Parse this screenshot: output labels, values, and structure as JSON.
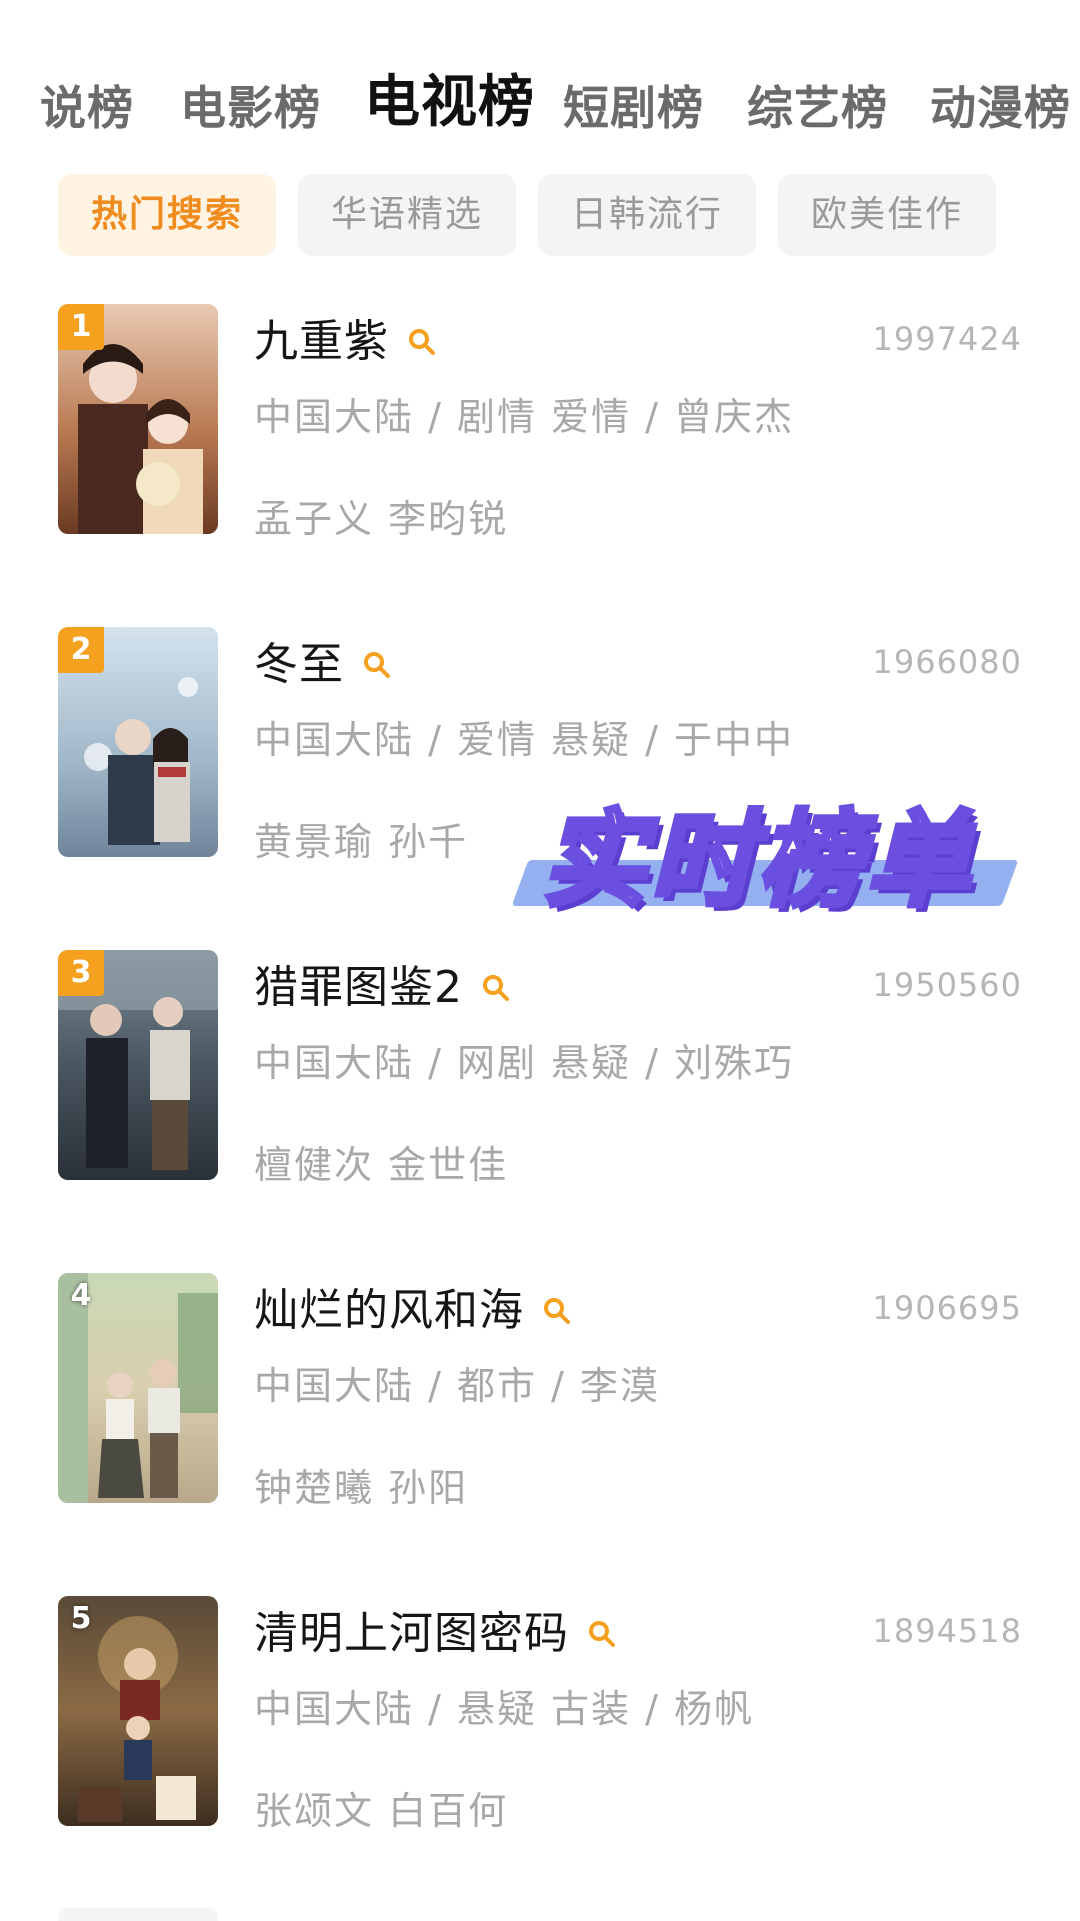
{
  "top_tabs": [
    {
      "label": "说榜"
    },
    {
      "label": "电影榜"
    },
    {
      "label": "电视榜"
    },
    {
      "label": "短剧榜"
    },
    {
      "label": "综艺榜"
    },
    {
      "label": "动漫榜"
    }
  ],
  "active_top_tab": "电视榜",
  "filters": [
    {
      "label": "热门搜索"
    },
    {
      "label": "华语精选"
    },
    {
      "label": "日韩流行"
    },
    {
      "label": "欧美佳作"
    }
  ],
  "active_filter": "热门搜索",
  "items": [
    {
      "rank": "1",
      "title": "九重紫",
      "count": "1997424",
      "meta": "中国大陆 / 剧情 爱情 / 曾庆杰",
      "cast": "孟子义 李昀锐"
    },
    {
      "rank": "2",
      "title": "冬至",
      "count": "1966080",
      "meta": "中国大陆 / 爱情 悬疑 / 于中中",
      "cast": "黄景瑜 孙千"
    },
    {
      "rank": "3",
      "title": "猎罪图鉴2",
      "count": "1950560",
      "meta": "中国大陆 / 网剧 悬疑 / 刘殊巧",
      "cast": "檀健次 金世佳"
    },
    {
      "rank": "4",
      "title": "灿烂的风和海",
      "count": "1906695",
      "meta": "中国大陆 / 都市 / 李漠",
      "cast": "钟楚曦 孙阳"
    },
    {
      "rank": "5",
      "title": "清明上河图密码",
      "count": "1894518",
      "meta": "中国大陆 / 悬疑 古装 / 杨帆",
      "cast": "张颂文 白百何"
    }
  ],
  "overlay": {
    "text": "实时榜单"
  },
  "colors": {
    "accent": "#f5a01e",
    "accent_text": "#f08c1e",
    "overlay_stroke": "#6b4fe0",
    "overlay_bar": "#8aa7f0"
  },
  "icons": {
    "search": "search-icon"
  }
}
